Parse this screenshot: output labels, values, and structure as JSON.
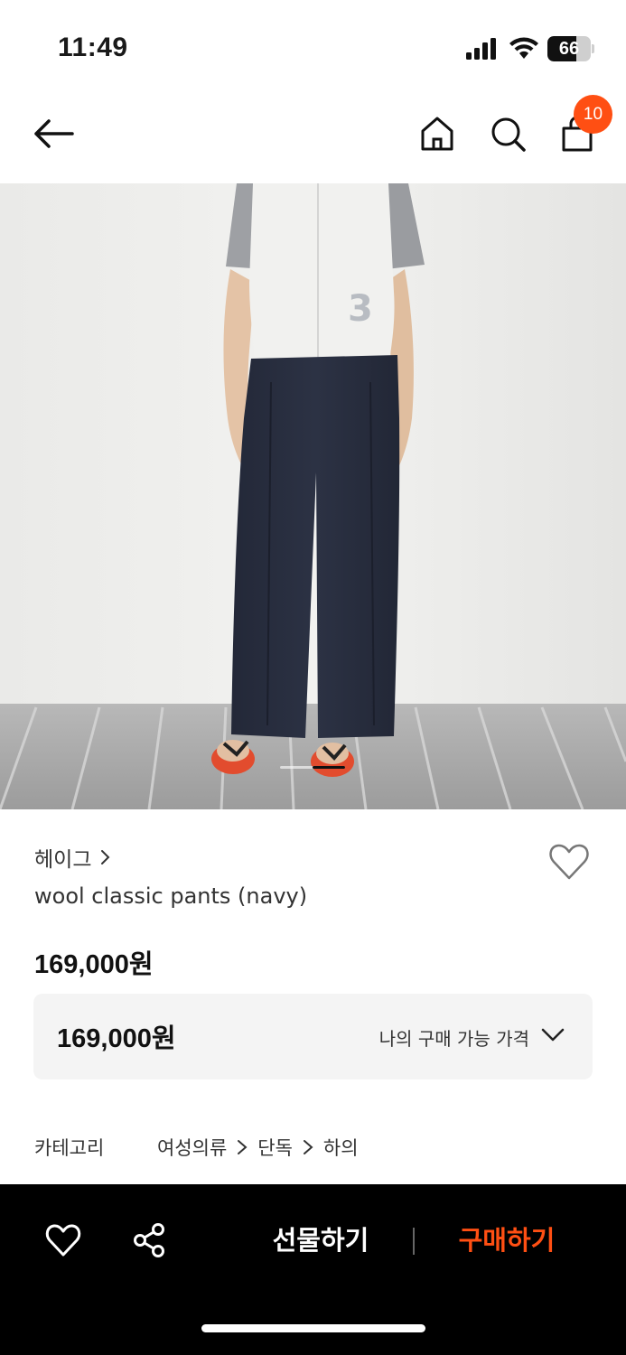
{
  "status_bar": {
    "time": "11:49",
    "battery_percent": 66,
    "battery_label": "66"
  },
  "nav": {
    "cart_count": "10",
    "accent_color": "#ff4f13"
  },
  "product": {
    "brand": "헤이그",
    "name": "wool classic pants (navy)",
    "price": "169,000원",
    "my_price": "169,000원",
    "my_price_label": "나의 구매 가능 가격",
    "category_label": "카테고리",
    "category_path": [
      "여성의류",
      "단독",
      "하의"
    ],
    "carousel_position": 0.5
  },
  "bottom_bar": {
    "gift_label": "선물하기",
    "buy_label": "구매하기"
  }
}
